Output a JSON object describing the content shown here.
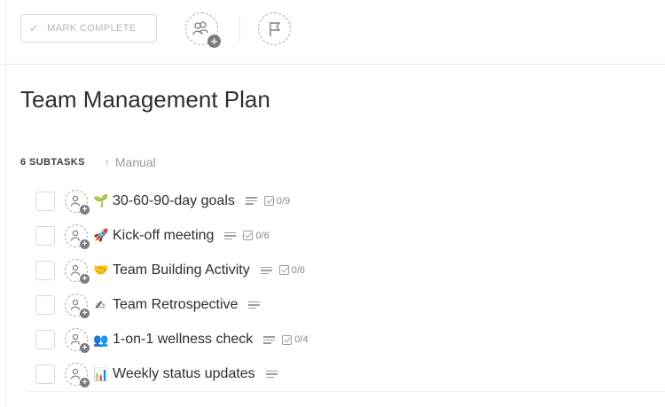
{
  "toolbar": {
    "mark_complete_label": "MARK COMPLETE",
    "mark_complete_icon": "check-icon",
    "assignees_icon": "add-assignees-icon",
    "flag_icon": "flag-icon"
  },
  "task": {
    "title": "Team Management Plan"
  },
  "subtasks": {
    "count_label": "6 SUBTASKS",
    "sort_label": "Manual",
    "items": [
      {
        "emoji": "🌱",
        "name": "30-60-90-day goals",
        "checklist": "0/9"
      },
      {
        "emoji": "🚀",
        "name": "Kick-off meeting",
        "checklist": "0/6"
      },
      {
        "emoji": "🤝",
        "name": "Team Building Activity",
        "checklist": "0/6"
      },
      {
        "emoji": "✍",
        "name": "Team Retrospective",
        "checklist": ""
      },
      {
        "emoji": "👥",
        "name": "1-on-1 wellness check",
        "checklist": "0/4"
      },
      {
        "emoji": "📊",
        "name": "Weekly status updates",
        "checklist": ""
      }
    ]
  },
  "colors": {
    "accent_grey": "#7c7c82",
    "border": "#d9d9dd",
    "text": "#2a2e34"
  }
}
